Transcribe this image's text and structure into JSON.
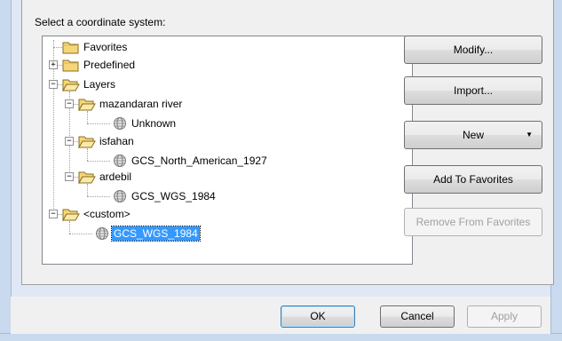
{
  "prompt": "Select a coordinate system:",
  "tree": {
    "favorites": "Favorites",
    "predefined": "Predefined",
    "layers": "Layers",
    "mazandaran": "mazandaran river",
    "mazandaran_cs": "Unknown",
    "isfahan": "isfahan",
    "isfahan_cs": "GCS_North_American_1927",
    "ardebil": "ardebil",
    "ardebil_cs": "GCS_WGS_1984",
    "custom": "<custom>",
    "custom_cs": "GCS_WGS_1984"
  },
  "buttons": {
    "modify": "Modify...",
    "import": "Import...",
    "new": "New",
    "add_favorites": "Add To Favorites",
    "remove_favorites": "Remove From Favorites"
  },
  "footer": {
    "ok": "OK",
    "cancel": "Cancel",
    "apply": "Apply"
  },
  "colors": {
    "selection": "#3399ff",
    "folder": "#f5d77a"
  }
}
